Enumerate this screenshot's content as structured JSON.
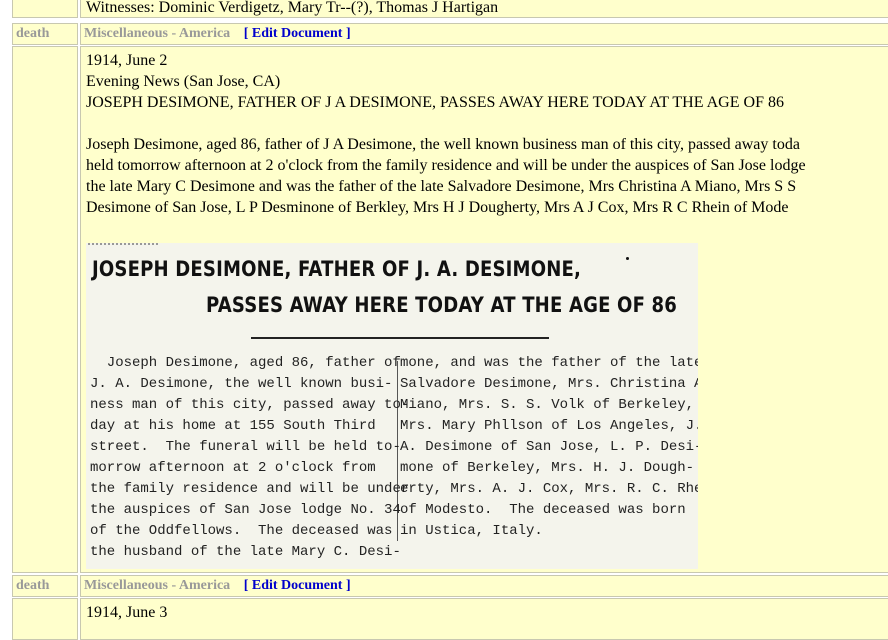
{
  "witness_line": "Witnesses: Dominic Verdigetz, Mary Tr--(?), Thomas J Hartigan",
  "records": [
    {
      "type": "death",
      "category": "Miscellaneous - America",
      "edit_label": "[ Edit Document ]",
      "date": "1914, June 2",
      "source": "Evening News (San Jose, CA)",
      "headline": "JOSEPH DESIMONE, FATHER OF J A DESIMONE, PASSES AWAY HERE TODAY AT THE AGE OF 86",
      "body_lines": [
        "Joseph Desimone, aged 86, father of J A Desimone, the well known business man of this city, passed away toda",
        "held tomorrow afternoon at 2 o'clock from the family residence and will be under the auspices of San Jose lodge",
        "the late Mary C Desimone and was the father of the late Salvadore Desimone, Mrs Christina A Miano, Mrs S S",
        "Desimone of San Jose, L P Desminone of Berkley, Mrs H J Dougherty, Mrs A J Cox, Mrs R C Rhein of Mode"
      ],
      "clipping": {
        "headline1": "JOSEPH DESIMONE, FATHER OF J. A. DESIMONE,",
        "headline2": "PASSES AWAY HERE TODAY AT THE AGE OF 86",
        "col1": [
          "  Joseph Desimone, aged 86, father of",
          "J. A. Desimone, the well known busi-",
          "ness man of this city, passed away to-",
          "day at his home at 155 South Third",
          "street.  The funeral will be held to-",
          "morrow afternoon at 2 o'clock from",
          "the family residence and will be under",
          "the auspices of San Jose lodge No. 34",
          "of the Oddfellows.  The deceased was",
          "the husband of the late Mary C. Desi-"
        ],
        "col2": [
          "mone, and was the father of the late",
          "Salvadore Desimone, Mrs. Christina A.",
          "Miano, Mrs. S. S. Volk of Berkeley,",
          "Mrs. Mary Phllson of Los Angeles, J.",
          "A. Desimone of San Jose, L. P. Desi-",
          "mone of Berkeley, Mrs. H. J. Dough-",
          "erty, Mrs. A. J. Cox, Mrs. R. C. Rhein",
          "of Modesto.  The deceased was born",
          "in Ustica, Italy."
        ]
      }
    },
    {
      "type": "death",
      "category": "Miscellaneous - America",
      "edit_label": "[ Edit Document ]",
      "date": "1914, June 3"
    }
  ]
}
